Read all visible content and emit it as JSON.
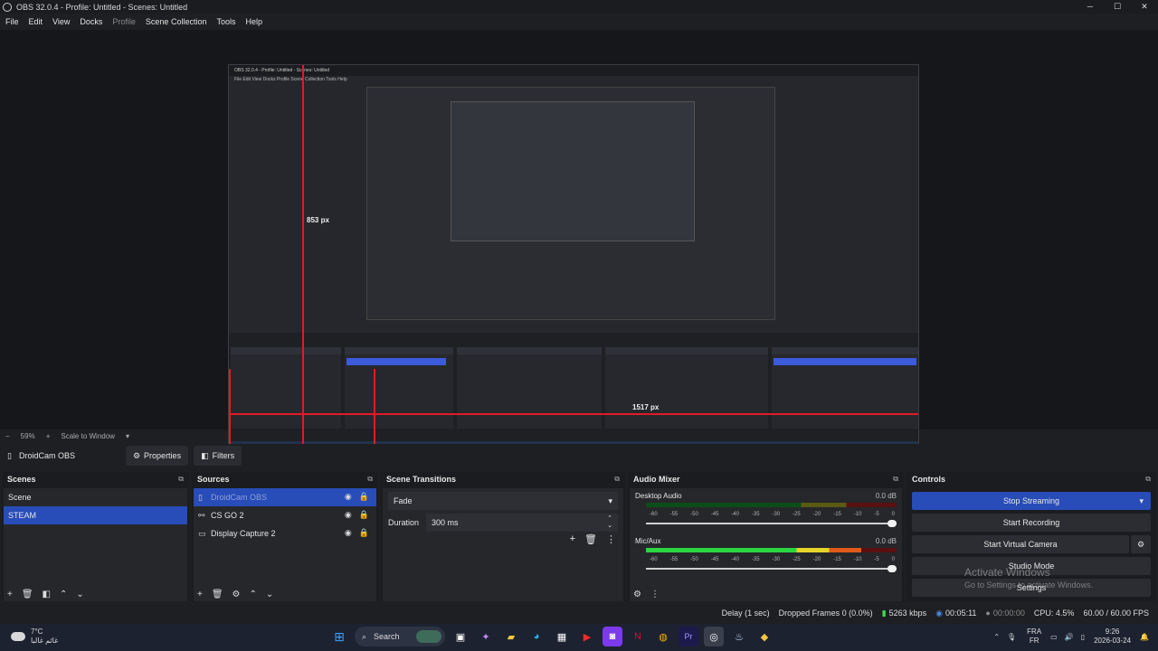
{
  "window": {
    "title": "OBS 32.0.4 - Profile: Untitled - Scenes: Untitled",
    "min": "─",
    "max": "☐",
    "close": "✕"
  },
  "menu": [
    "File",
    "Edit",
    "View",
    "Docks",
    "Profile",
    "Scene Collection",
    "Tools",
    "Help"
  ],
  "preview": {
    "height_label": "853 px",
    "width_label": "1517 px",
    "inner_title": "OBS 32.0.4 - Profile: Untitled - Scenes: Untitled",
    "inner_menu": "File  Edit  View  Docks  Profile  Scene Collection  Tools  Help"
  },
  "zoom": {
    "minus": "−",
    "value": "59%",
    "plus": "+",
    "scale_label": "Scale to Window"
  },
  "source_toolbar": {
    "source_name": "DroidCam OBS",
    "properties": "Properties",
    "filters": "Filters"
  },
  "scenes": {
    "title": "Scenes",
    "items": [
      "Scene",
      "STEAM"
    ],
    "selected": 1
  },
  "sources": {
    "title": "Sources",
    "items": [
      {
        "name": "DroidCam OBS",
        "selected": true
      },
      {
        "name": "CS GO 2",
        "selected": false
      },
      {
        "name": "Display Capture 2",
        "selected": false
      }
    ]
  },
  "transitions": {
    "title": "Scene Transitions",
    "type": "Fade",
    "duration_label": "Duration",
    "duration_value": "300 ms"
  },
  "audio": {
    "title": "Audio Mixer",
    "ticks": [
      "-60",
      "-55",
      "-50",
      "-45",
      "-40",
      "-35",
      "-30",
      "-25",
      "-20",
      "-15",
      "-10",
      "-5",
      "0"
    ],
    "channels": [
      {
        "name": "Desktop Audio",
        "db": "0.0 dB",
        "level": 0.0
      },
      {
        "name": "Mic/Aux",
        "db": "0.0 dB",
        "level": 0.86
      }
    ]
  },
  "controls": {
    "title": "Controls",
    "stop_streaming": "Stop Streaming",
    "start_recording": "Start Recording",
    "start_virtual_camera": "Start Virtual Camera",
    "studio_mode": "Studio Mode",
    "settings": "Settings",
    "watermark_1": "Activate Windows",
    "watermark_2": "Go to Settings to activate Windows."
  },
  "status": {
    "delay": "Delay (1 sec)",
    "dropped": "Dropped Frames 0 (0.0%)",
    "bitrate": "5263 kbps",
    "stream_time": "00:05:11",
    "rec_time": "00:00:00",
    "cpu": "CPU: 4.5%",
    "fps": "60.00 / 60.00 FPS"
  },
  "taskbar": {
    "temp": "7°C",
    "weather_text": "غائم غالبا",
    "search": "Search",
    "lang_1": "FRA",
    "lang_2": "FR",
    "time": "9:26",
    "date": "2026-03-24"
  },
  "colors": {
    "accent": "#284cb8",
    "red_guide": "#e01b24",
    "meter_green": "#2bd641"
  }
}
